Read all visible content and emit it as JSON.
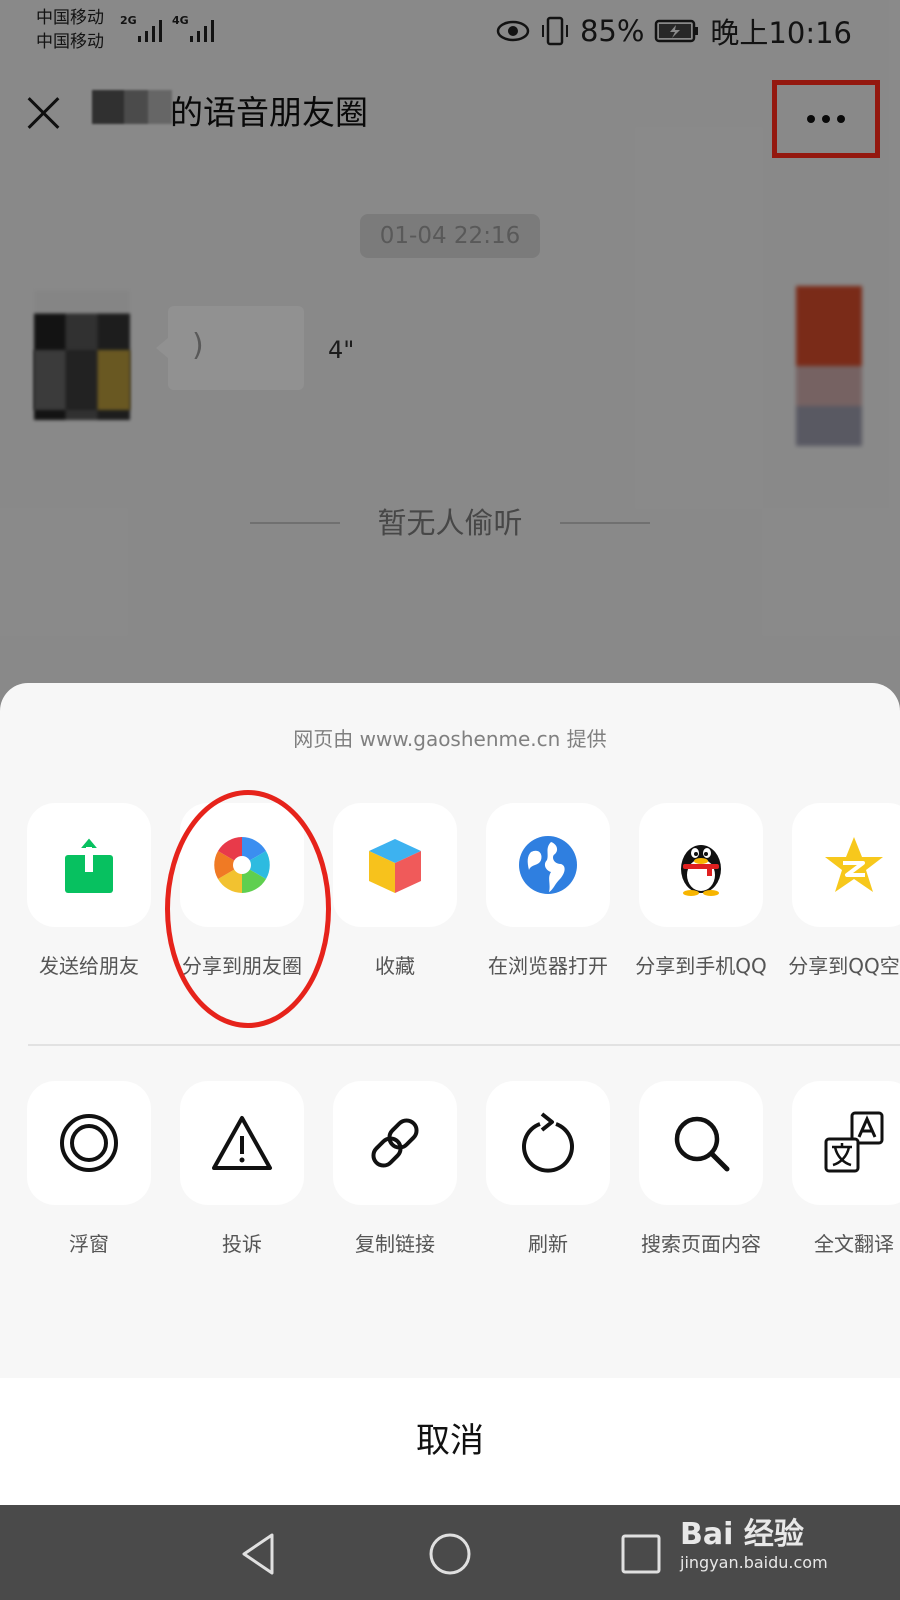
{
  "status_bar": {
    "carrier_1": "中国移动",
    "carrier_2": "中国移动",
    "net_1": "2G",
    "net_2": "4G",
    "battery": "85%",
    "time": "晚上10:16"
  },
  "header": {
    "title": "的语音朋友圈"
  },
  "post": {
    "timestamp": "01-04 22:16",
    "voice_duration": "4\"",
    "no_listen": "暂无人偷听"
  },
  "sheet": {
    "provider": "网页由 www.gaoshenme.cn 提供",
    "row1": [
      {
        "label": "发送给朋友",
        "icon": "share-export-icon"
      },
      {
        "label": "分享到朋友圈",
        "icon": "moments-aperture-icon"
      },
      {
        "label": "收藏",
        "icon": "favorite-cube-icon"
      },
      {
        "label": "在浏览器打开",
        "icon": "globe-icon"
      },
      {
        "label": "分享到手机QQ",
        "icon": "qq-penguin-icon"
      },
      {
        "label": "分享到QQ空间",
        "icon": "qzone-star-icon"
      }
    ],
    "row2": [
      {
        "label": "浮窗",
        "icon": "float-window-icon"
      },
      {
        "label": "投诉",
        "icon": "warning-icon"
      },
      {
        "label": "复制链接",
        "icon": "link-icon"
      },
      {
        "label": "刷新",
        "icon": "refresh-icon"
      },
      {
        "label": "搜索页面内容",
        "icon": "search-icon"
      },
      {
        "label": "全文翻译",
        "icon": "translate-icon"
      }
    ],
    "cancel": "取消"
  },
  "watermark": {
    "brand": "Bai 经验",
    "url": "jingyan.baidu.com"
  },
  "colors": {
    "highlight_red": "#e6231b",
    "share_green": "#07c160",
    "globe_blue": "#2f7fe0"
  }
}
